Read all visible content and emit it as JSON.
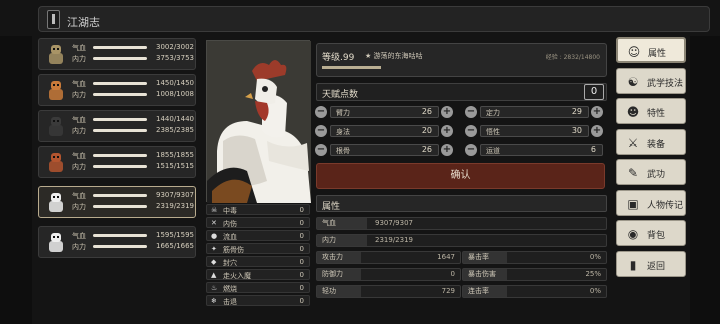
{
  "header": {
    "title": "江湖志"
  },
  "characters": [
    {
      "name_hp": "气血",
      "hp": "3002/3002",
      "name_mp": "内力",
      "mp": "3753/3753",
      "color": "#a89466"
    },
    {
      "name_hp": "气血",
      "hp": "1450/1450",
      "name_mp": "内力",
      "mp": "1008/1008",
      "color": "#c87a3a"
    },
    {
      "name_hp": "气血",
      "hp": "1440/1440",
      "name_mp": "内力",
      "mp": "2385/2385",
      "color": "#3a3a3a"
    },
    {
      "name_hp": "气血",
      "hp": "1855/1855",
      "name_mp": "内力",
      "mp": "1515/1515",
      "color": "#b3552f"
    },
    {
      "name_hp": "气血",
      "hp": "9307/9307",
      "name_mp": "内力",
      "mp": "2319/2319",
      "color": "#eeeeee"
    },
    {
      "name_hp": "气血",
      "hp": "1595/1595",
      "name_mp": "内力",
      "mp": "1665/1665",
      "color": "#eeeeee"
    }
  ],
  "status_effects": [
    {
      "icon": "poison-icon",
      "glyph": "☠",
      "name": "中毒",
      "value": "0"
    },
    {
      "icon": "broken-heart-icon",
      "glyph": "✕",
      "name": "内伤",
      "value": "0"
    },
    {
      "icon": "blood-drop-icon",
      "glyph": "●",
      "name": "流血",
      "value": "0"
    },
    {
      "icon": "bone-icon",
      "glyph": "✦",
      "name": "筋骨伤",
      "value": "0"
    },
    {
      "icon": "acupoint-icon",
      "glyph": "◆",
      "name": "封穴",
      "value": "0"
    },
    {
      "icon": "flame-icon",
      "glyph": "▲",
      "name": "走火入魔",
      "value": "0"
    },
    {
      "icon": "fire-icon",
      "glyph": "♨",
      "name": "燃烧",
      "value": "0"
    },
    {
      "icon": "snowflake-icon",
      "glyph": "❄",
      "name": "击退",
      "value": "0"
    }
  ],
  "level": {
    "label": "等级.99",
    "star": "★",
    "name": "游荡的东海咕咕",
    "xp": "经验 : 2832/14800",
    "xp_fraction": 0.19
  },
  "talent": {
    "label": "天赋点数",
    "value": "0"
  },
  "attributes": [
    {
      "name": "臂力",
      "value": "26",
      "has_plus": true
    },
    {
      "name": "定力",
      "value": "29",
      "has_plus": true
    },
    {
      "name": "身法",
      "value": "20",
      "has_plus": true
    },
    {
      "name": "悟性",
      "value": "30",
      "has_plus": true
    },
    {
      "name": "根骨",
      "value": "26",
      "has_plus": true
    },
    {
      "name": "运道",
      "value": "6",
      "has_plus": false
    }
  ],
  "confirm_label": "确认",
  "props": {
    "title": "属性",
    "hp_label": "气血",
    "hp_value": "9307/9307",
    "mp_label": "内力",
    "mp_value": "2319/2319",
    "grid": [
      {
        "k": "攻击力",
        "v": "1647"
      },
      {
        "k": "暴击率",
        "v": "0%"
      },
      {
        "k": "防御力",
        "v": "0"
      },
      {
        "k": "暴击伤害",
        "v": "25%"
      },
      {
        "k": "轻功",
        "v": "729"
      },
      {
        "k": "连击率",
        "v": "0%"
      }
    ]
  },
  "menu": [
    {
      "icon": "person-icon",
      "glyph": "☺",
      "label": "属性",
      "active": true
    },
    {
      "icon": "martial-arts-icon",
      "glyph": "☯",
      "label": "武学技法",
      "active": false
    },
    {
      "icon": "trait-icon",
      "glyph": "☻",
      "label": "特性",
      "active": false
    },
    {
      "icon": "sword-icon",
      "glyph": "⚔",
      "label": "装备",
      "active": false
    },
    {
      "icon": "scroll-icon",
      "glyph": "✎",
      "label": "武功",
      "active": false
    },
    {
      "icon": "book-icon",
      "glyph": "▣",
      "label": "人物传记",
      "active": false
    },
    {
      "icon": "bag-icon",
      "glyph": "◉",
      "label": "背包",
      "active": false
    },
    {
      "icon": "return-icon",
      "glyph": "▮",
      "label": "返回",
      "active": false
    }
  ]
}
